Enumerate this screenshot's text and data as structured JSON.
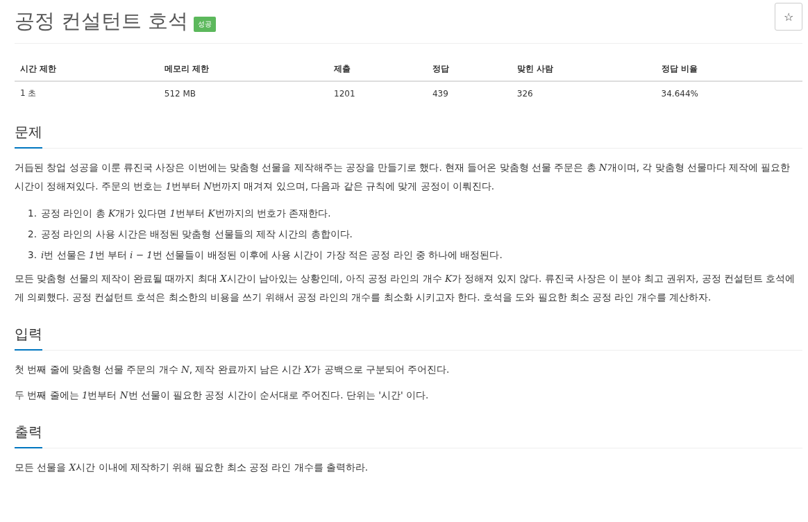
{
  "title": "공정 컨설턴트 호석",
  "badge": "성공",
  "star_button": "☆",
  "info_table": {
    "columns": [
      "시간 제한",
      "메모리 제한",
      "제출",
      "정답",
      "맞힌 사람",
      "정답 비율"
    ],
    "rows": [
      [
        "1 초",
        "512 MB",
        "1201",
        "439",
        "326",
        "34.644%"
      ]
    ]
  },
  "sections": [
    {
      "heading": "문제",
      "blocks": [
        {
          "kind": "paragraph",
          "parts": [
            {
              "text": "거듭된 창업 성공을 이룬 류진국 사장은 이번에는 맞춤형 선물을 제작해주는 공장을 만들기로 했다. 현재 들어온 맞춤형 선물 주문은 총 ",
              "math": false
            },
            {
              "text": "N",
              "math": true
            },
            {
              "text": "개이며, 각 맞춤형 선물마다 제작에 필요한 시간이 정해져있다. 주문의 번호는 ",
              "math": false
            },
            {
              "text": "1",
              "math": true
            },
            {
              "text": "번부터 ",
              "math": false
            },
            {
              "text": "N",
              "math": true
            },
            {
              "text": "번까지 매겨져 있으며, 다음과 같은 규칙에 맞게 공정이 이뤄진다.",
              "math": false
            }
          ]
        },
        {
          "kind": "list",
          "items": [
            {
              "marker": "1.",
              "parts": [
                {
                  "text": "공정 라인이 총 ",
                  "math": false
                },
                {
                  "text": "K",
                  "math": true
                },
                {
                  "text": "개가 있다면 ",
                  "math": false
                },
                {
                  "text": "1",
                  "math": true
                },
                {
                  "text": "번부터 ",
                  "math": false
                },
                {
                  "text": "K",
                  "math": true
                },
                {
                  "text": "번까지의 번호가 존재한다.",
                  "math": false
                }
              ]
            },
            {
              "marker": "2.",
              "parts": [
                {
                  "text": "공정 라인의 사용 시간은 배정된 맞춤형 선물들의 제작 시간의 총합이다.",
                  "math": false
                }
              ]
            },
            {
              "marker": "3.",
              "parts": [
                {
                  "text": "i",
                  "math": true
                },
                {
                  "text": "번 선물은 ",
                  "math": false
                },
                {
                  "text": "1",
                  "math": true
                },
                {
                  "text": "번 부터 ",
                  "math": false
                },
                {
                  "text": "i − 1",
                  "math": true
                },
                {
                  "text": "번 선물들이 배정된 이후에 사용 시간이 가장 적은 공정 라인 중 하나에 배정된다.",
                  "math": false
                }
              ]
            }
          ]
        },
        {
          "kind": "paragraph",
          "parts": [
            {
              "text": "모든 맞춤형 선물의 제작이 완료될 때까지 최대 ",
              "math": false
            },
            {
              "text": "X",
              "math": true
            },
            {
              "text": "시간이 남아있는 상황인데, 아직 공정 라인의 개수 ",
              "math": false
            },
            {
              "text": "K",
              "math": true
            },
            {
              "text": "가 정해져 있지 않다. 류진국 사장은 이 분야 최고 권위자, 공정 컨설턴트 호석에게 의뢰했다. 공정 컨설턴트 호석은 최소한의 비용을 쓰기 위해서 공정 라인의 개수를 최소화 시키고자 한다. 호석을 도와 필요한 최소 공정 라인 개수를 계산하자.",
              "math": false
            }
          ]
        }
      ]
    },
    {
      "heading": "입력",
      "blocks": [
        {
          "kind": "paragraph",
          "parts": [
            {
              "text": "첫 번째 줄에 맞춤형 선물 주문의 개수 ",
              "math": false
            },
            {
              "text": "N",
              "math": true
            },
            {
              "text": ", 제작 완료까지 남은 시간 ",
              "math": false
            },
            {
              "text": "X",
              "math": true
            },
            {
              "text": "가 공백으로 구분되어 주어진다.",
              "math": false
            }
          ]
        },
        {
          "kind": "paragraph",
          "parts": [
            {
              "text": "두 번째 줄에는 ",
              "math": false
            },
            {
              "text": "1",
              "math": true
            },
            {
              "text": "번부터 ",
              "math": false
            },
            {
              "text": "N",
              "math": true
            },
            {
              "text": "번 선물이 필요한 공정 시간이 순서대로 주어진다. 단위는 '시간' 이다.",
              "math": false
            }
          ]
        }
      ]
    },
    {
      "heading": "출력",
      "blocks": [
        {
          "kind": "paragraph",
          "parts": [
            {
              "text": "모든 선물을 ",
              "math": false
            },
            {
              "text": "X",
              "math": true
            },
            {
              "text": "시간 이내에 제작하기 위해 필요한 최소 공정 라인 개수를 출력하라.",
              "math": false
            }
          ]
        }
      ]
    }
  ]
}
